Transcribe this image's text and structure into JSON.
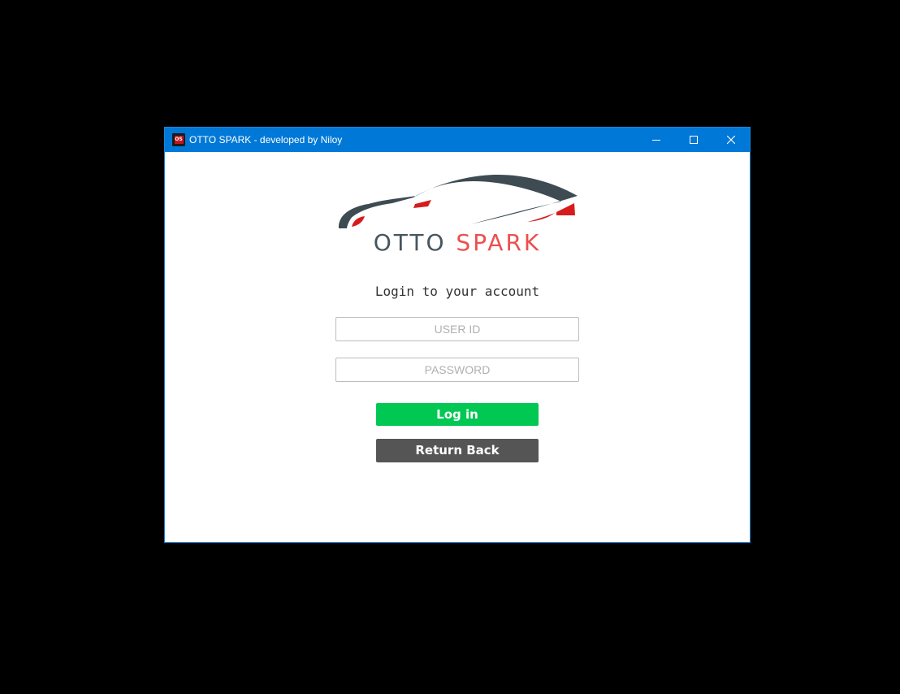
{
  "window": {
    "title": "OTTO SPARK - developed by Niloy",
    "icon": "app-logo-icon",
    "icon_text": "OS",
    "controls": {
      "minimize": "minimize-icon",
      "maximize": "maximize-icon",
      "close": "close-icon"
    },
    "accent_color": "#0078d7"
  },
  "logo": {
    "word1": "OTTO",
    "word2": "SPARK",
    "word1_color": "#46555e",
    "word2_color": "#ec4f4f",
    "graphic": "car-silhouette"
  },
  "login": {
    "heading": "Login to your account",
    "user_id": {
      "value": "",
      "placeholder": "USER ID"
    },
    "password": {
      "value": "",
      "placeholder": "PASSWORD"
    },
    "login_button": {
      "label": "Log in",
      "color": "#00c853"
    },
    "return_button": {
      "label": "Return Back",
      "color": "#555555"
    }
  }
}
